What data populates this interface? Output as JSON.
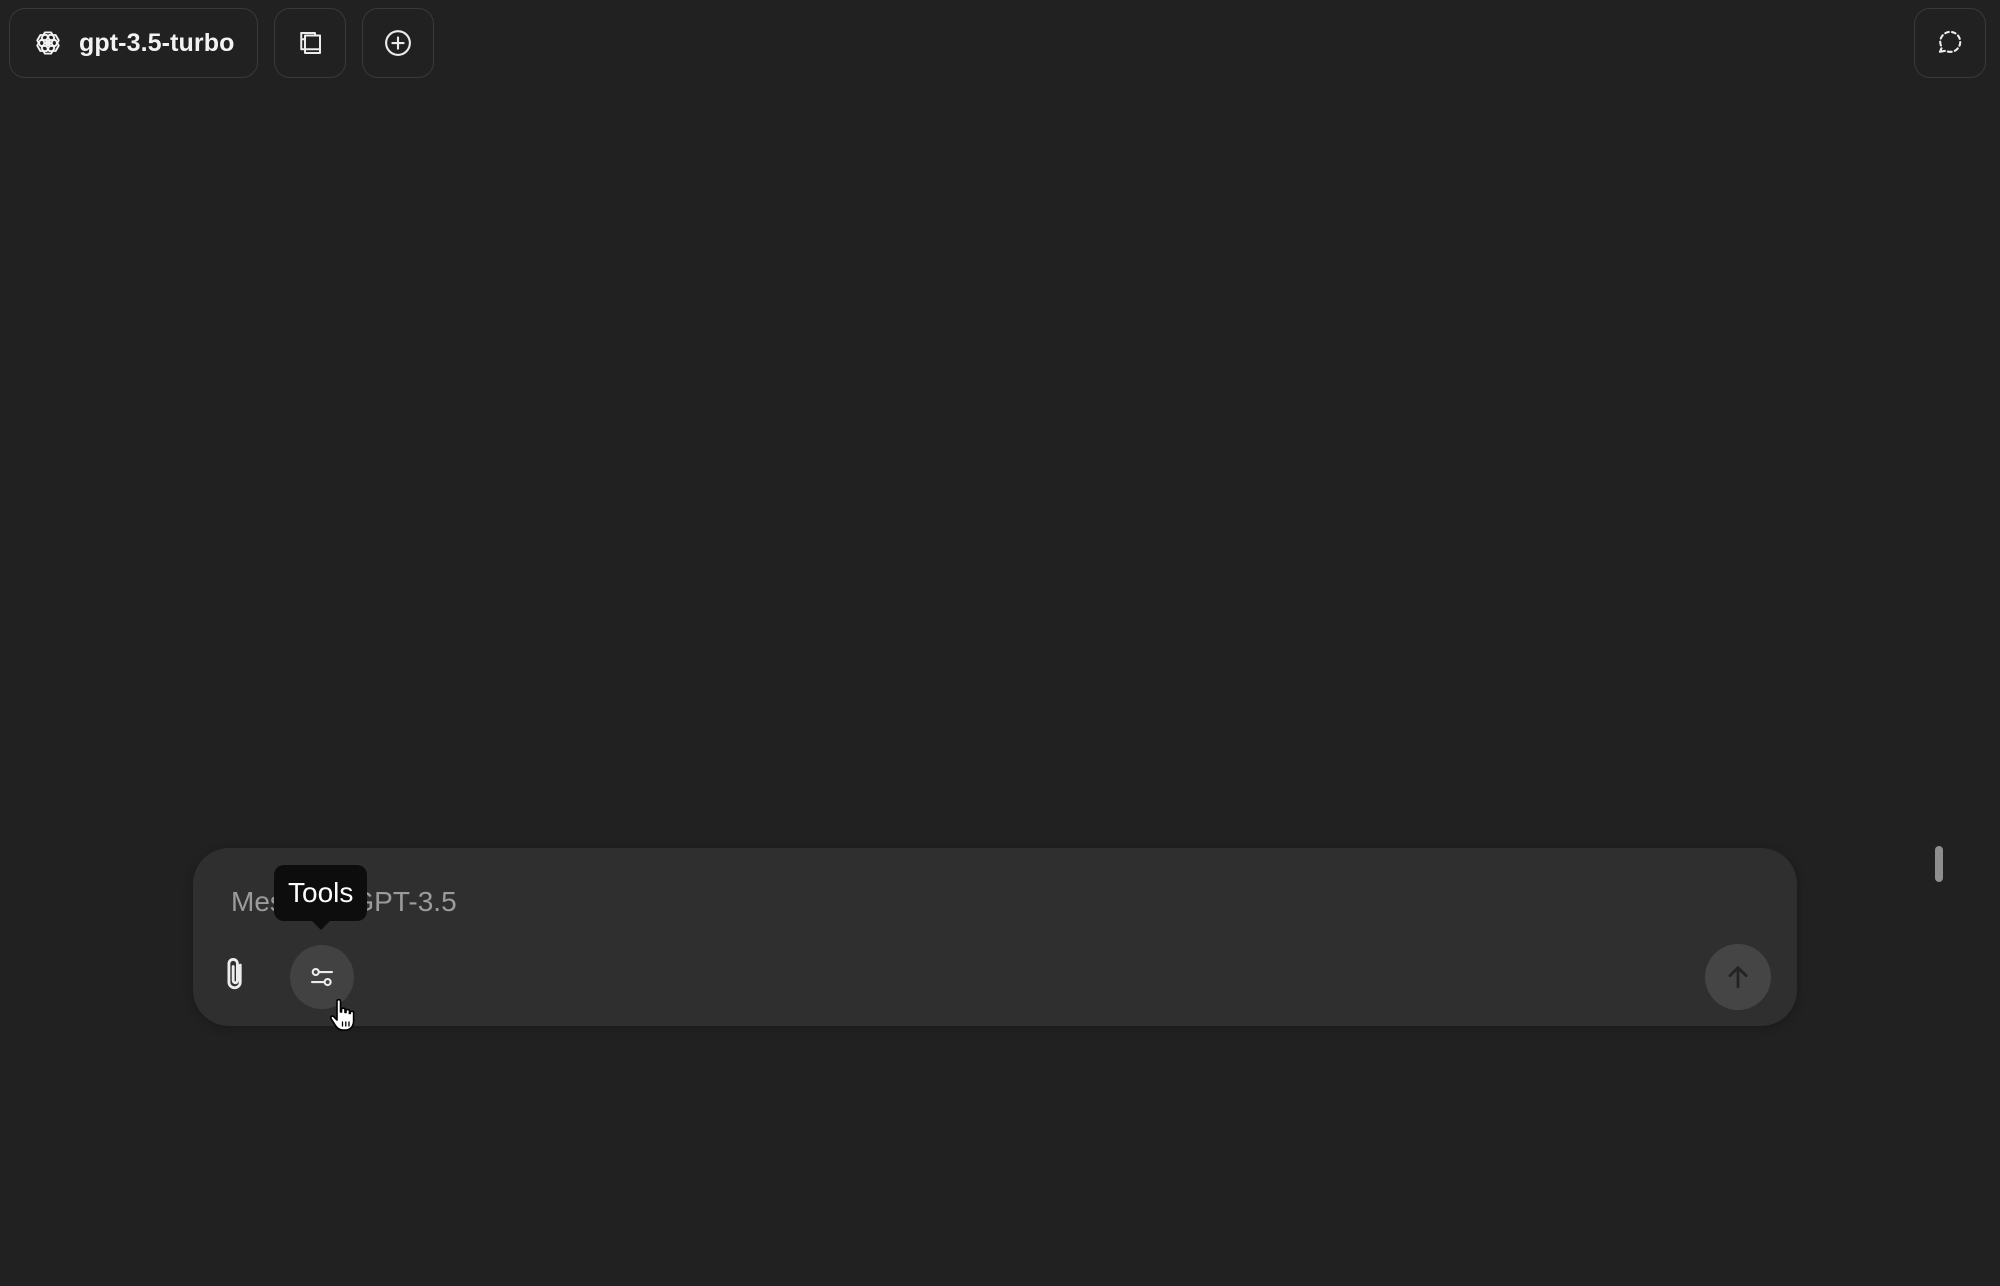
{
  "header": {
    "model_label": "gpt-3.5-turbo",
    "model_icon": "openai-logo-icon",
    "sidebar_toggle_icon": "library-icon",
    "new_chat_icon": "plus-circle-icon",
    "temporary_chat_icon": "dashed-chat-bubble-icon"
  },
  "composer": {
    "placeholder": "Message GPT-3.5",
    "attach_icon": "paperclip-icon",
    "tools_icon": "sliders-icon",
    "send_icon": "arrow-up-icon"
  },
  "tooltip": {
    "text": "Tools"
  },
  "colors": {
    "background": "#212121",
    "composer": "#2f2f2f",
    "tooltip": "#0d0d0d",
    "tools_button": "#424242",
    "send_button": "#454545"
  }
}
